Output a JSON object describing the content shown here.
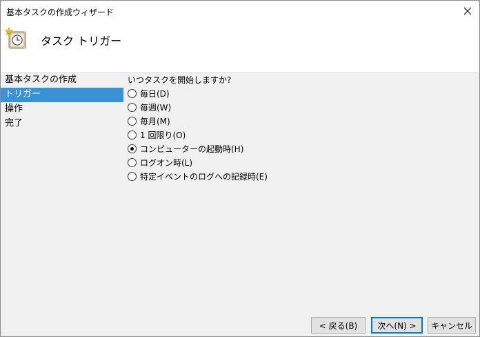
{
  "window": {
    "title": "基本タスクの作成ウィザード"
  },
  "header": {
    "title": "タスク トリガー"
  },
  "sidebar": {
    "items": [
      {
        "label": "基本タスクの作成",
        "selected": false
      },
      {
        "label": "トリガー",
        "selected": true
      },
      {
        "label": "操作",
        "selected": false
      },
      {
        "label": "完了",
        "selected": false
      }
    ]
  },
  "content": {
    "question": "いつタスクを開始しますか?",
    "options": [
      {
        "label": "毎日(D)",
        "checked": false
      },
      {
        "label": "毎週(W)",
        "checked": false
      },
      {
        "label": "毎月(M)",
        "checked": false
      },
      {
        "label": "1 回限り(O)",
        "checked": false
      },
      {
        "label": "コンピューターの起動時(H)",
        "checked": true
      },
      {
        "label": "ログオン時(L)",
        "checked": false
      },
      {
        "label": "特定イベントのログへの記録時(E)",
        "checked": false
      }
    ]
  },
  "footer": {
    "back_label": "< 戻る(B)",
    "next_label": "次へ(N) >",
    "cancel_label": "キャンセル"
  },
  "colors": {
    "selection": "#3b91d6",
    "default_button_border": "#0078d7"
  }
}
